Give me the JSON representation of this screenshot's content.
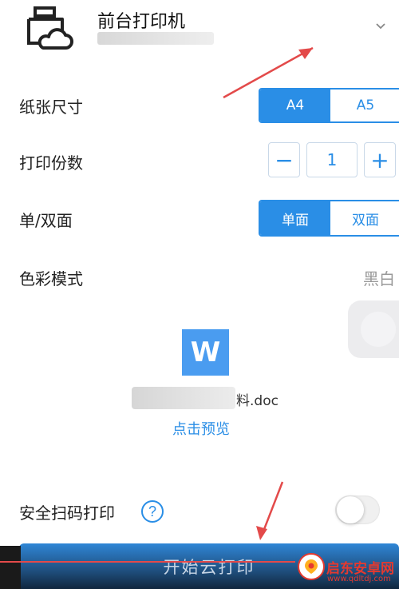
{
  "header": {
    "printer_name": "前台打印机",
    "printer_icon": "cloud-printer-icon",
    "dropdown_icon": "chevron-down-icon"
  },
  "paper_size": {
    "label": "纸张尺寸",
    "options": [
      "A4",
      "A5"
    ],
    "selected": "A4"
  },
  "copies": {
    "label": "打印份数",
    "minus": "−",
    "value": "1",
    "plus": "+"
  },
  "sides": {
    "label": "单/双面",
    "options": [
      "单面",
      "双面"
    ],
    "selected": "单面"
  },
  "color_mode": {
    "label": "色彩模式",
    "value": "黑白"
  },
  "document": {
    "icon_letter": "W",
    "name_suffix": "料.doc",
    "preview_link": "点击预览"
  },
  "secure_print": {
    "label": "安全扫码打印",
    "help_icon": "?",
    "enabled": false
  },
  "footer": {
    "print_button": "开始云打印"
  },
  "watermark": {
    "text": "启东安卓网",
    "url": "www.qdltdj.com"
  },
  "colors": {
    "accent": "#2a8ee6",
    "annotation": "#e34a4a"
  }
}
